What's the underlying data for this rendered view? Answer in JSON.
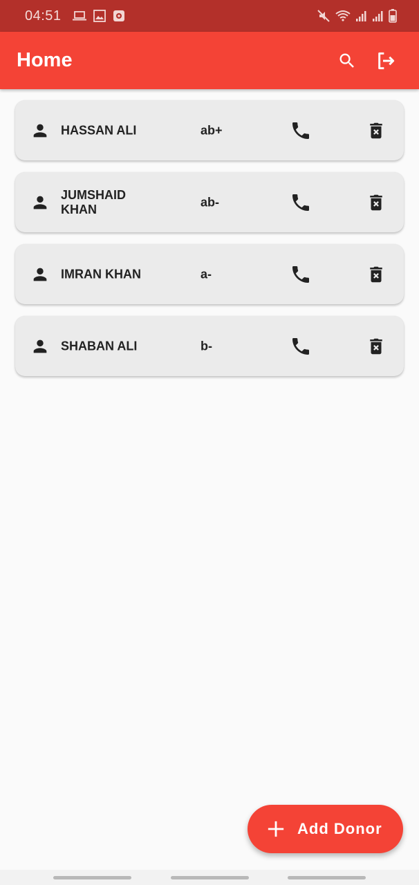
{
  "status_bar": {
    "time": "04:51",
    "icons": [
      "laptop-icon",
      "image-icon",
      "app-notification-icon",
      "mute-icon",
      "wifi-icon",
      "signal-icon",
      "signal-icon-2",
      "battery-icon"
    ]
  },
  "app_bar": {
    "title": "Home",
    "actions": [
      "search-icon",
      "logout-icon"
    ],
    "color": "#f44336"
  },
  "donors": [
    {
      "name": "HASSAN ALI",
      "blood_group": "ab+"
    },
    {
      "name": "JUMSHAID KHAN",
      "blood_group": "ab-"
    },
    {
      "name": "IMRAN KHAN",
      "blood_group": "a-"
    },
    {
      "name": "SHABAN ALI",
      "blood_group": "b-"
    }
  ],
  "fab": {
    "label": "Add Donor",
    "icon": "plus-icon"
  }
}
